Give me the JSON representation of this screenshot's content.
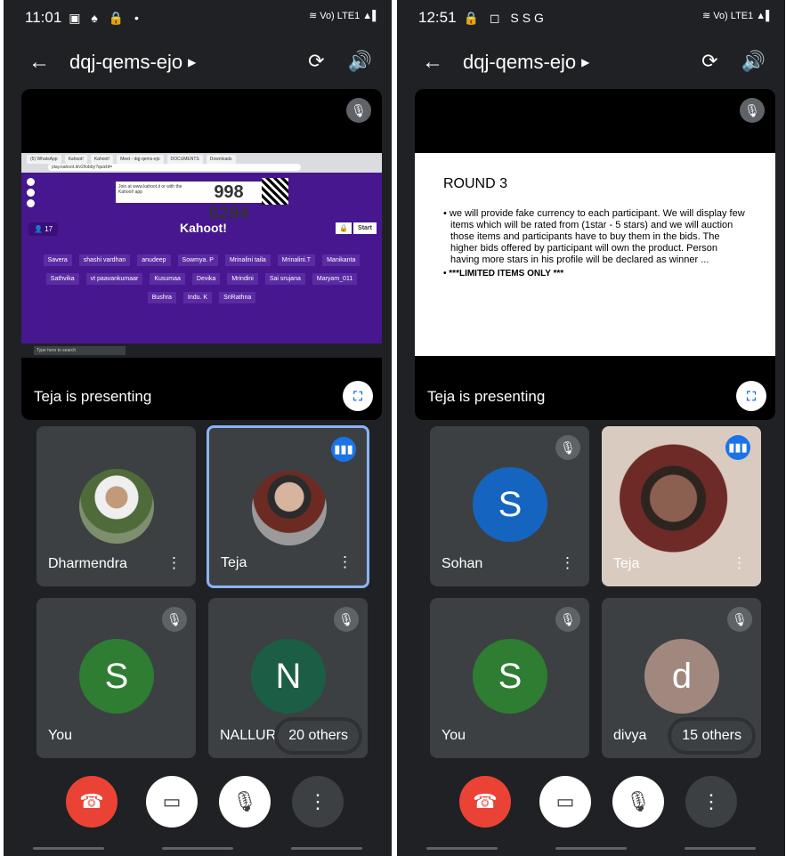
{
  "left": {
    "status_time": "11:01",
    "status_icons": "▣ ♠ 🔒 •",
    "status_right": "≋ Vo) LTE1 ▲▌",
    "meeting_code": "dqj-qems-ejo",
    "presenting_label": "Teja is presenting",
    "share": {
      "tabs": [
        "(5) WhatsApp",
        "Kahoot!",
        "Kahoot!",
        "Meet - dqj-qems-ejo",
        "DOCUMENTS",
        "Downloads"
      ],
      "url": "play.kahoot.it/v2/lobby?quizId=",
      "join_text": "Join at www.kahoot.it or with the Kahoot! app",
      "game_pin": "998 6294",
      "logo": "Kahoot!",
      "player_count": "17",
      "start_label": "Start",
      "players": [
        "Savera",
        "shashi vardhan",
        "anudeep",
        "Sowmya. P",
        "Mrinalini taila",
        "Mrinalini.T",
        "Manikanta",
        "Sathvika",
        "vt paavankumaar",
        "Kusumaa",
        "Devika",
        "Mrindini",
        "Sai srujana",
        "Maryam_011",
        "Bushra",
        "Indu. K",
        "SriRathna"
      ],
      "taskbar_search": "Type here to search"
    },
    "tiles": [
      {
        "name": "Dharmendra"
      },
      {
        "name": "Teja"
      },
      {
        "name": "You",
        "initial": "S"
      },
      {
        "name": "NALLURI",
        "initial": "N",
        "others": "20 others"
      }
    ]
  },
  "right": {
    "status_time": "12:51",
    "status_icons": "🔒 ◻ SSG",
    "status_right": "≋ Vo) LTE1 ▲▌",
    "meeting_code": "dqj-qems-ejo",
    "presenting_label": "Teja is presenting",
    "slide": {
      "title": "ROUND 3",
      "bullet1": "• we will provide fake currency to each participant. We will display few items which will be rated from (1star - 5 stars) and we will auction those items and participants have to buy them in the bids. The higher bids offered by participant will own the product. Person having more stars in his profile will be declared as winner ...",
      "bullet2": "• ***LIMITED ITEMS ONLY ***"
    },
    "tiles": [
      {
        "name": "Sohan",
        "initial": "S"
      },
      {
        "name": "Teja"
      },
      {
        "name": "You",
        "initial": "S"
      },
      {
        "name": "divya",
        "initial": "d",
        "others": "15 others"
      }
    ]
  },
  "icons": {
    "back": "←",
    "caret": "▶",
    "switch_camera": "⟳",
    "speaker": "🔊",
    "mic_off": "🎙",
    "fullscreen": "⛶",
    "speaking": "▮▮▮",
    "more_vert": "⋮",
    "hangup": "☎",
    "camera_off": "▭",
    "more": "⋮"
  },
  "colors": {
    "hangup": "#ea4335",
    "tile_bg": "#3c4043",
    "active_border": "#8ab4f8",
    "avatar_sohan": "#1565c0",
    "avatar_you": "#2e7d32",
    "avatar_nalluri": "#1b5e45",
    "avatar_divya": "#a1887f"
  }
}
